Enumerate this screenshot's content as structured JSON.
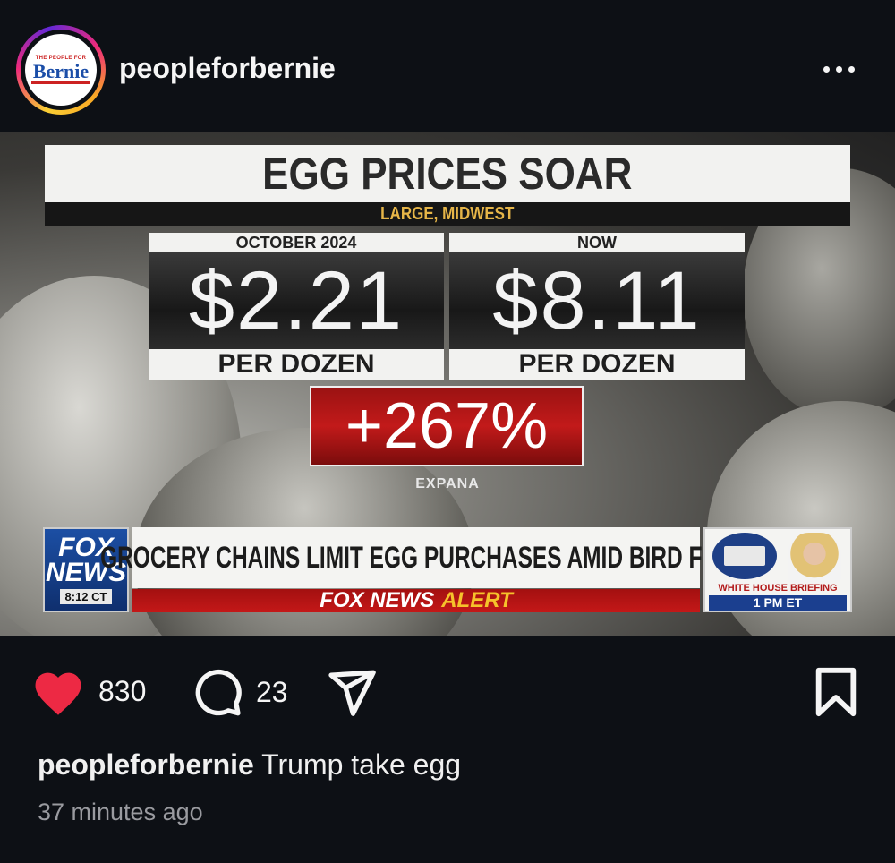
{
  "post": {
    "username": "peopleforbernie",
    "avatar": {
      "small_text": "THE PEOPLE FOR",
      "logo_text": "Bernie"
    },
    "more_icon": "more-horizontal-icon"
  },
  "media": {
    "title": "EGG PRICES SOAR",
    "subtitle": "LARGE, MIDWEST",
    "left": {
      "caption": "OCTOBER 2024",
      "price": "$2.21",
      "unit": "PER DOZEN"
    },
    "right": {
      "caption": "NOW",
      "price": "$8.11",
      "unit": "PER DOZEN"
    },
    "change": "+267%",
    "source": "EXPANA",
    "ticker": {
      "network_line1": "FOX",
      "network_line2": "NEWS",
      "time": "8:12 CT",
      "headline": "GROCERY CHAINS LIMIT EGG PURCHASES AMID BIRD FLU",
      "alert_brand": "FOX NEWS",
      "alert_word": "ALERT",
      "side_title": "WHITE HOUSE BRIEFING",
      "side_time": "1 PM ET"
    }
  },
  "actions": {
    "likes": "830",
    "comments": "23",
    "icons": [
      "heart-icon",
      "comment-icon",
      "share-icon",
      "bookmark-icon"
    ],
    "like_color": "#ed2944"
  },
  "caption": {
    "username": "peopleforbernie",
    "text": "Trump take egg"
  },
  "timestamp": "37 minutes ago"
}
